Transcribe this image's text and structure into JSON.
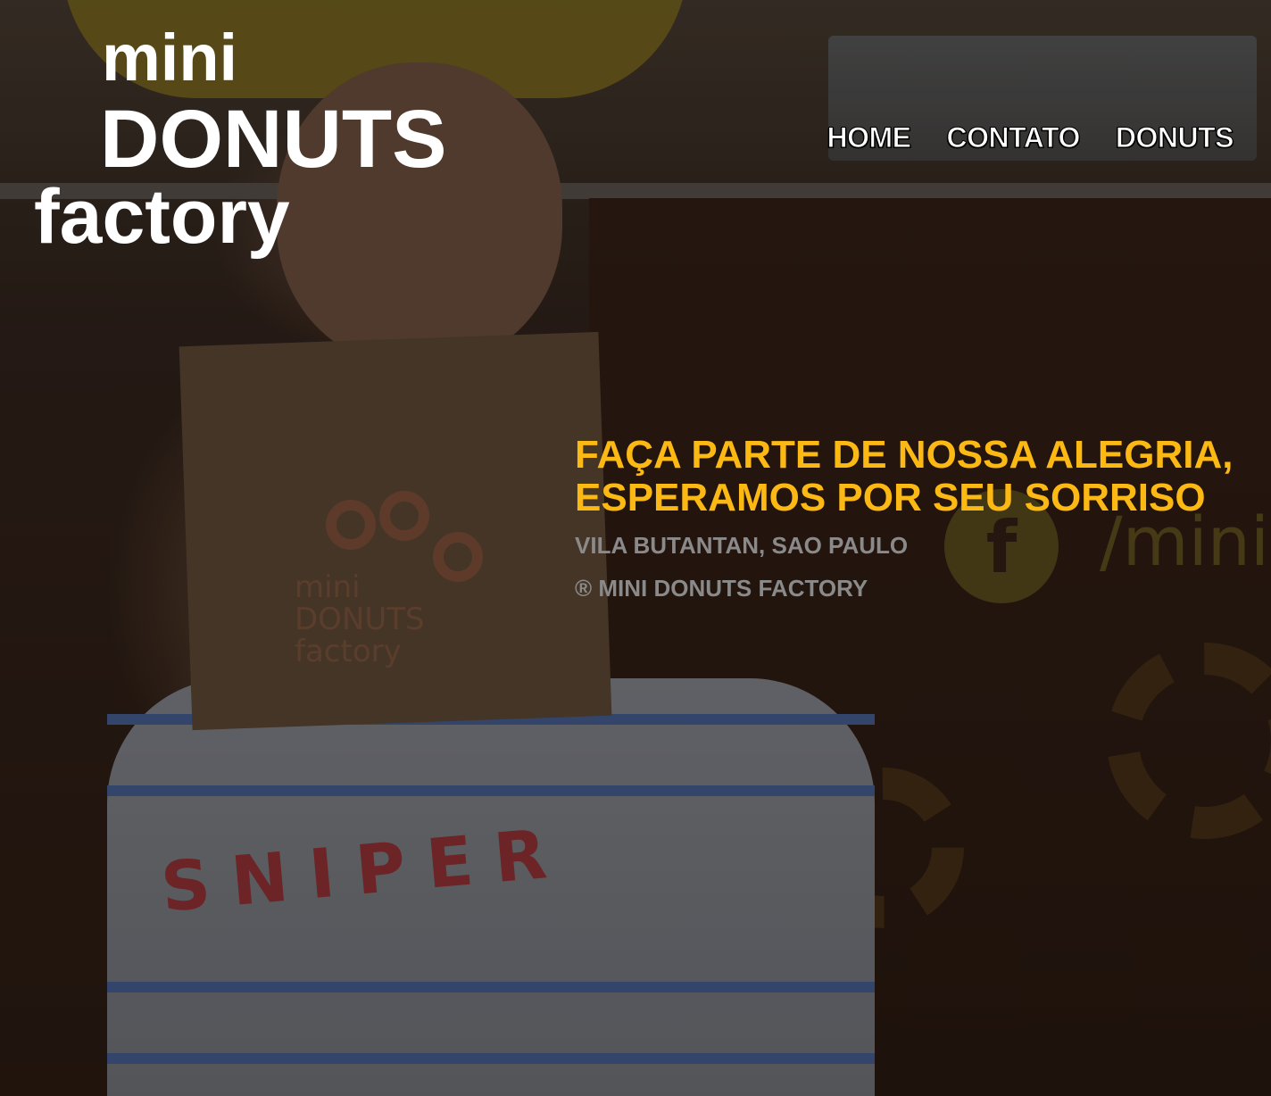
{
  "brand": {
    "logo_line1": "mini",
    "logo_line2": "DONUTS",
    "logo_line3": "factory"
  },
  "nav": {
    "items": [
      {
        "label": "HOME"
      },
      {
        "label": "CONTATO"
      },
      {
        "label": "DONUTS"
      }
    ]
  },
  "hero": {
    "tagline_line1": "FAÇA PARTE DE NOSSA ALEGRIA,",
    "tagline_line2": "ESPERAMOS POR SEU SORRISO",
    "location": "VILA BUTANTAN, SAO PAULO",
    "copyright": "® MINI DONUTS FACTORY"
  },
  "photo": {
    "bag_line1": "mini",
    "bag_line2": "DONUTS",
    "bag_line3": "factory",
    "shirt_text": "SNIPER",
    "sign_icon": "f",
    "sign_text": "/mini"
  },
  "colors": {
    "accent": "#fcb813",
    "nav_text": "#ffffff",
    "muted_text": "#8a8a8a"
  }
}
